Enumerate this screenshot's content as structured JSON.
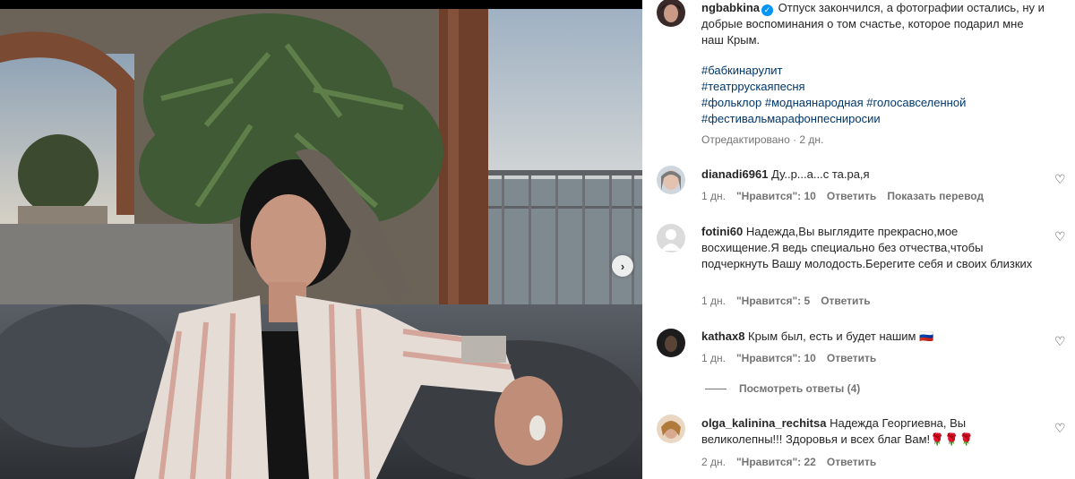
{
  "post": {
    "author": "ngbabkina",
    "caption": "Отпуск закончился, а фотографии остались, ну и добрые воспоминания о том счастье, которое подарил мне наш Крым.",
    "hashtags": [
      "#бабкинарулит",
      "#театррускаяпесня",
      "#фольклор",
      "#моднаянародная",
      "#голосавселенной",
      "#фестивальмарафонпесниросии"
    ],
    "edited": "Отредактировано · 2 дн."
  },
  "comments": [
    {
      "user": "dianadi6961",
      "text": "Ду..р...а...с та.ра,я",
      "time": "1 дн.",
      "likes": "\"Нравится\": 10",
      "reply": "Ответить",
      "translate": "Показать перевод"
    },
    {
      "user": "fotini60",
      "text": "Надежда,Вы выглядите прекрасно,мое восхищение.Я ведь специально без отчества,чтобы подчеркнуть Вашу молодость.Берегите себя и своих близких",
      "time": "1 дн.",
      "likes": "\"Нравится\": 5",
      "reply": "Ответить"
    },
    {
      "user": "kathax8",
      "text": "Крым был, есть и будет нашим 🇷🇺",
      "time": "1 дн.",
      "likes": "\"Нравится\": 10",
      "reply": "Ответить",
      "view_replies": "Посмотреть ответы (4)"
    },
    {
      "user": "olga_kalinina_rechitsa",
      "text": "Надежда Георгиевна, Вы великолепны!!! Здоровья и всех благ Вам!🌹🌹🌹",
      "time": "2 дн.",
      "likes": "\"Нравится\": 22",
      "reply": "Ответить"
    }
  ],
  "icons": {
    "next": "chevron-right-icon",
    "like": "heart-outline-icon",
    "verified": "verified-badge-icon"
  },
  "colors": {
    "link": "#00376b",
    "verified": "#0095f6",
    "muted": "#737373"
  }
}
